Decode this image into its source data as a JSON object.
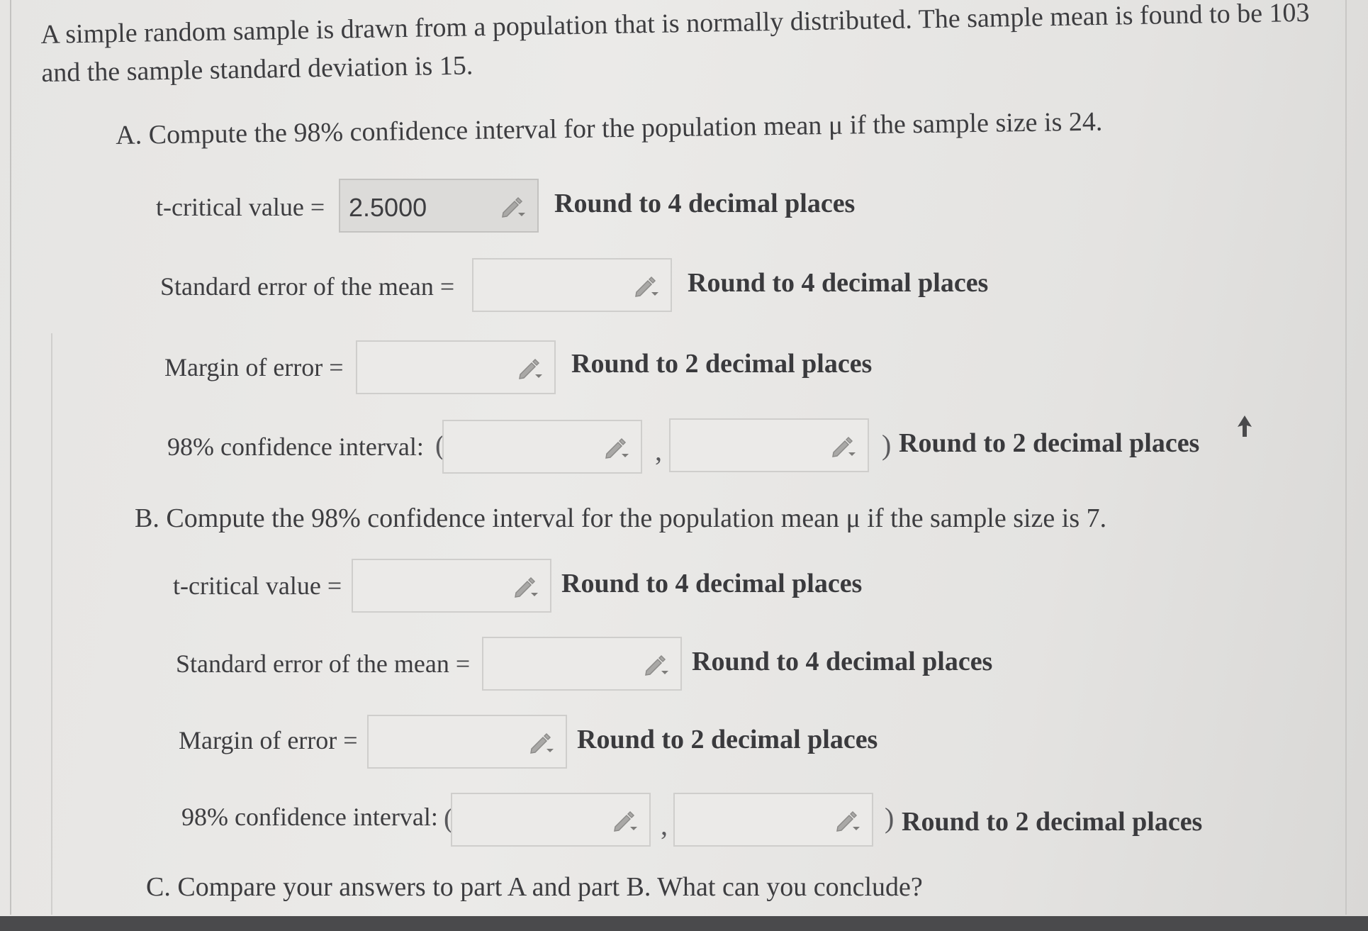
{
  "problem": {
    "intro": "A simple random sample is drawn from a population that is normally distributed. The sample mean is found to be 103 and the sample standard deviation is 15."
  },
  "part_a": {
    "heading": "A. Compute the 98% confidence interval for the population mean μ if the sample size is 24.",
    "t_critical_label": "t-critical value =",
    "t_critical_value": "2.5000",
    "t_critical_hint": "Round to 4 decimal places",
    "se_label": "Standard error of the mean =",
    "se_value": "",
    "se_hint": "Round to 4 decimal places",
    "moe_label": "Margin of error =",
    "moe_value": "",
    "moe_hint": "Round to 2 decimal places",
    "ci_label": "98% confidence interval:",
    "ci_lower": "",
    "ci_upper": "",
    "ci_open": "(",
    "ci_sep": ",",
    "ci_close": ")",
    "ci_hint": "Round to 2 decimal places"
  },
  "part_b": {
    "heading": "B. Compute the 98% confidence interval for the population mean μ if the sample size is 7.",
    "t_critical_label": "t-critical value =",
    "t_critical_value": "",
    "t_critical_hint": "Round to 4 decimal places",
    "se_label": "Standard error of the mean =",
    "se_value": "",
    "se_hint": "Round to 4 decimal places",
    "moe_label": "Margin of error =",
    "moe_value": "",
    "moe_hint": "Round to 2 decimal places",
    "ci_label": "98% confidence interval:",
    "ci_lower": "",
    "ci_upper": "",
    "ci_open": "(",
    "ci_sep": ",",
    "ci_close": ")",
    "ci_hint": "Round to 2 decimal places"
  },
  "part_c": {
    "heading": "C. Compare your answers to part A and part B. What can you conclude?"
  },
  "icons": {
    "input_edit": "pencil-dropdown-icon",
    "pointer": "mouse-cursor-icon"
  },
  "colors": {
    "page_background": "#e8e7e5",
    "input_background": "#ebeae8",
    "filled_input_background": "#dcdbd9",
    "input_border": "#cfcecc",
    "text": "#3d3d40",
    "bottom_bar": "#4a4a4c"
  }
}
